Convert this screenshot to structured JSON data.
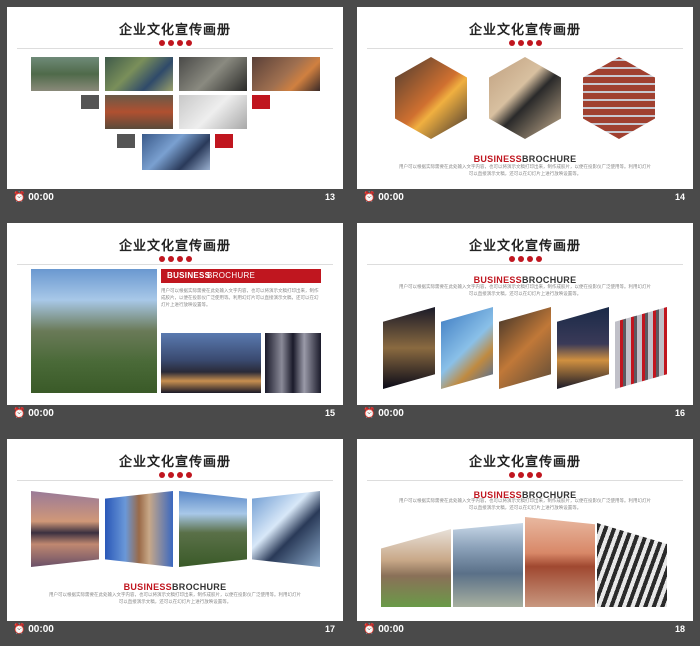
{
  "slides": [
    {
      "title": "企业文化宣传画册",
      "clock": "00:00",
      "page": "13"
    },
    {
      "title": "企业文化宣传画册",
      "clock": "00:00",
      "page": "14",
      "heading_red": "BUSINESS",
      "heading_dark": "BROCHURE",
      "para": "用户可以根据实际需要在此处输入文字内容，也可以将演示文稿打印出来，制作成胶片，以便在投影仪广泛使用等。利用幻灯片可以直接演示文稿，还可以在幻灯片上进行放映设置等。"
    },
    {
      "title": "企业文化宣传画册",
      "clock": "00:00",
      "page": "15",
      "heading_red": "BUSINESS",
      "heading_dark": "BROCHURE",
      "para": "用户可以根据实际需要在此处输入文字内容，也可以将演示文稿打印出来，制作成胶片，以便在投影仪广泛使用等。利用幻灯片可以直接演示文稿，还可以在幻灯片上进行放映设置等。"
    },
    {
      "title": "企业文化宣传画册",
      "clock": "00:00",
      "page": "16",
      "heading_red": "BUSINESS",
      "heading_dark": "BROCHURE",
      "para": "用户可以根据实际需要在此处输入文字内容，也可以将演示文稿打印出来，制作成胶片，以便在投影仪广泛使用等。利用幻灯片可以直接演示文稿，还可以在幻灯片上进行放映设置等。"
    },
    {
      "title": "企业文化宣传画册",
      "clock": "00:00",
      "page": "17",
      "heading_red": "BUSINESS",
      "heading_dark": "BROCHURE",
      "para": "用户可以根据实际需要在此处输入文字内容，也可以将演示文稿打印出来，制作成胶片，以便在投影仪广泛使用等。利用幻灯片可以直接演示文稿，还可以在幻灯片上进行放映设置等。"
    },
    {
      "title": "企业文化宣传画册",
      "clock": "00:00",
      "page": "18",
      "heading_red": "BUSINESS",
      "heading_dark": "BROCHURE",
      "para": "用户可以根据实际需要在此处输入文字内容，也可以将演示文稿打印出来，制作成胶片，以便在投影仪广泛使用等。利用幻灯片可以直接演示文稿，还可以在幻灯片上进行放映设置等。"
    }
  ],
  "colors": {
    "accent": "#c0161f",
    "dark": "#333333",
    "frame": "#4a4a4a"
  }
}
